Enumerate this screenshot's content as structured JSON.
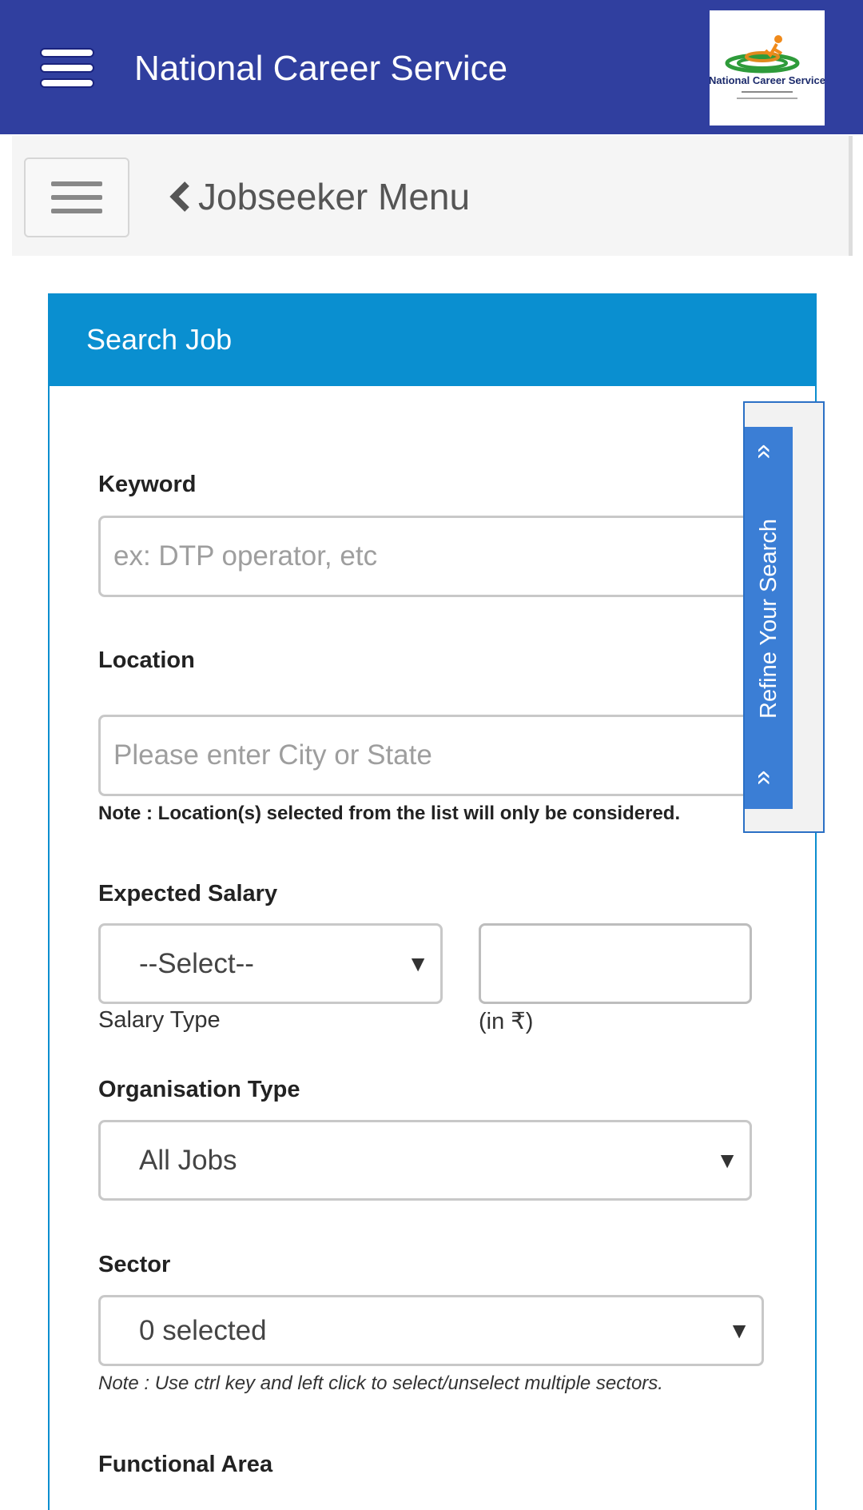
{
  "appbar": {
    "title": "National Career Service",
    "logo_text": "National Career Service"
  },
  "jobseeker_bar": {
    "title": "Jobseeker Menu"
  },
  "search_panel": {
    "title": "Search Job",
    "keyword": {
      "label": "Keyword",
      "placeholder": "ex: DTP operator, etc",
      "value": ""
    },
    "location": {
      "label": "Location",
      "placeholder": "Please enter City or State",
      "value": "",
      "note": "Note : Location(s) selected from the list will only be considered."
    },
    "expected_salary": {
      "label": "Expected Salary",
      "type_value": "--Select--",
      "type_caption": "Salary Type",
      "amount_value": "",
      "amount_caption": "(in ₹)"
    },
    "organisation_type": {
      "label": "Organisation Type",
      "value": "All Jobs"
    },
    "sector": {
      "label": "Sector",
      "value": "0 selected",
      "note": "Note : Use ctrl key and left click to select/unselect multiple sectors."
    },
    "functional_area": {
      "label": "Functional Area"
    }
  },
  "refine_tab": {
    "label": "Refine Your Search",
    "arrow_glyph": "«"
  },
  "colors": {
    "appbar": "#303f9f",
    "panel_header": "#0a8fd0",
    "refine_tab": "#3b7ed5"
  }
}
